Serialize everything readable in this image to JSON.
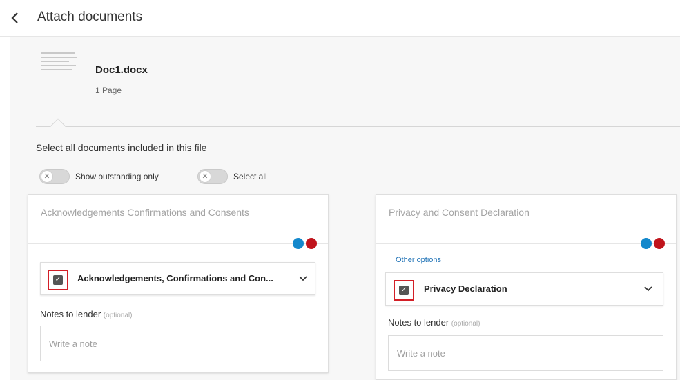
{
  "header": {
    "title": "Attach documents",
    "back_icon": "chevron-left-icon"
  },
  "document": {
    "name": "Doc1.docx",
    "pages": "1 Page",
    "thumbnail_icon": "document-thumbnail-icon"
  },
  "section": {
    "title": "Select all documents included in this file",
    "toggles": [
      {
        "label": "Show outstanding only",
        "on": false
      },
      {
        "label": "Select all",
        "on": false
      }
    ]
  },
  "cards": [
    {
      "title": "Acknowledgements Confirmations and Consents",
      "indicator_colors": [
        "#1488cc",
        "#c0141c"
      ],
      "document_option": {
        "label": "Acknowledgements, Confirmations and Con...",
        "checked": true
      },
      "notes_label": "Notes to lender",
      "notes_optional": "(optional)",
      "notes_placeholder": "Write a note"
    },
    {
      "title": "Privacy and Consent Declaration",
      "indicator_colors": [
        "#1488cc",
        "#c0141c"
      ],
      "other_options": "Other options",
      "document_option": {
        "label": "Privacy Declaration",
        "checked": true
      },
      "notes_label": "Notes to lender",
      "notes_optional": "(optional)",
      "notes_placeholder": "Write a note"
    }
  ]
}
